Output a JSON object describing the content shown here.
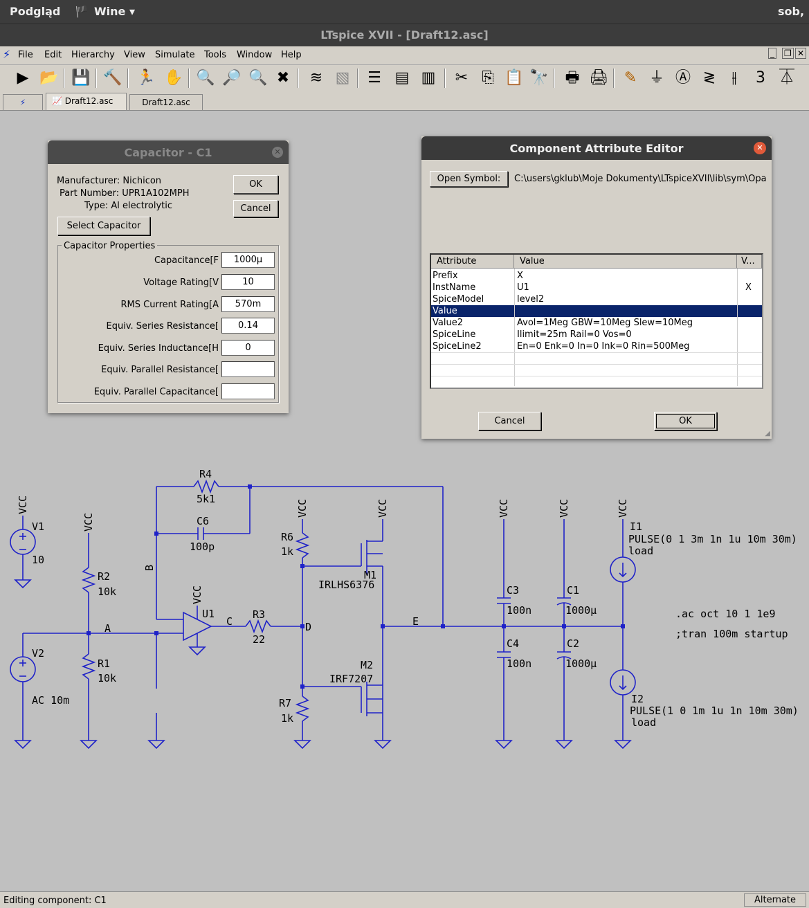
{
  "topbar": {
    "app": "Podgląd",
    "wine": "Wine ▾",
    "clock": "sob,"
  },
  "window": {
    "title": "LTspice XVII - [Draft12.asc]"
  },
  "menu": [
    "File",
    "Edit",
    "Hierarchy",
    "View",
    "Simulate",
    "Tools",
    "Window",
    "Help"
  ],
  "tabs": [
    "Draft12.asc",
    "Draft12.asc"
  ],
  "capacitor_dialog": {
    "title": "Capacitor - C1",
    "manufacturer": "Manufacturer: Nichicon",
    "part_number": "Part Number: UPR1A102MPH",
    "type": "Type: Al electrolytic",
    "ok": "OK",
    "cancel": "Cancel",
    "select": "Select Capacitor",
    "group": "Capacitor Properties",
    "props": [
      {
        "label": "Capacitance[F",
        "value": "1000µ"
      },
      {
        "label": "Voltage Rating[V",
        "value": "10"
      },
      {
        "label": "RMS Current Rating[A",
        "value": "570m"
      },
      {
        "label": "Equiv. Series Resistance[",
        "value": "0.14"
      },
      {
        "label": "Equiv. Series Inductance[H",
        "value": "0"
      },
      {
        "label": "Equiv. Parallel Resistance[",
        "value": ""
      },
      {
        "label": "Equiv. Parallel Capacitance[",
        "value": ""
      }
    ]
  },
  "attr_dialog": {
    "title": "Component Attribute Editor",
    "open_symbol": "Open Symbol:",
    "path": "C:\\users\\gklub\\Moje Dokumenty\\LTspiceXVII\\lib\\sym\\Opar",
    "headers": [
      "Attribute",
      "Value",
      "V..."
    ],
    "rows": [
      {
        "attr": "Prefix",
        "value": "X",
        "vis": ""
      },
      {
        "attr": "InstName",
        "value": "U1",
        "vis": "X"
      },
      {
        "attr": "SpiceModel",
        "value": "level2",
        "vis": ""
      },
      {
        "attr": "Value",
        "value": "",
        "vis": ""
      },
      {
        "attr": "Value2",
        "value": "Avol=1Meg GBW=10Meg Slew=10Meg",
        "vis": ""
      },
      {
        "attr": "SpiceLine",
        "value": "Ilimit=25m Rail=0 Vos=0",
        "vis": ""
      },
      {
        "attr": "SpiceLine2",
        "value": "En=0 Enk=0 In=0 Ink=0 Rin=500Meg",
        "vis": ""
      }
    ],
    "cancel": "Cancel",
    "ok": "OK"
  },
  "schematic": {
    "vcc": "VCC",
    "v1": "V1",
    "v1_val": "10",
    "v2": "V2",
    "v2_val": "AC 10m",
    "r1": "R1",
    "r1_val": "10k",
    "r2": "R2",
    "r2_val": "10k",
    "r3": "R3",
    "r3_val": "22",
    "r4": "R4",
    "r4_val": "5k1",
    "r6": "R6",
    "r6_val": "1k",
    "r7": "R7",
    "r7_val": "1k",
    "c1": "C1",
    "c1_val": "1000µ",
    "c2": "C2",
    "c2_val": "1000µ",
    "c3": "C3",
    "c3_val": "100n",
    "c4": "C4",
    "c4_val": "100n",
    "c6": "C6",
    "c6_val": "100p",
    "u1": "U1",
    "m1": "M1",
    "m1_val": "IRLHS6376",
    "m2": "M2",
    "m2_val": "IRF7207",
    "i1": "I1",
    "i1_val": "PULSE(0 1 3m 1n 1u 10m 30m)",
    "i1_load": "load",
    "i2": "I2",
    "i2_val": "PULSE(1 0 1m 1u 1n 10m 30m)",
    "i2_load": "load",
    "netA": "A",
    "netB": "B",
    "netC": "C",
    "netD": "D",
    "netE": "E",
    "directive1": ".ac oct 10 1 1e9",
    "directive2": ";tran 100m startup"
  },
  "status": {
    "text": "Editing component: C1",
    "mode": "Alternate"
  }
}
